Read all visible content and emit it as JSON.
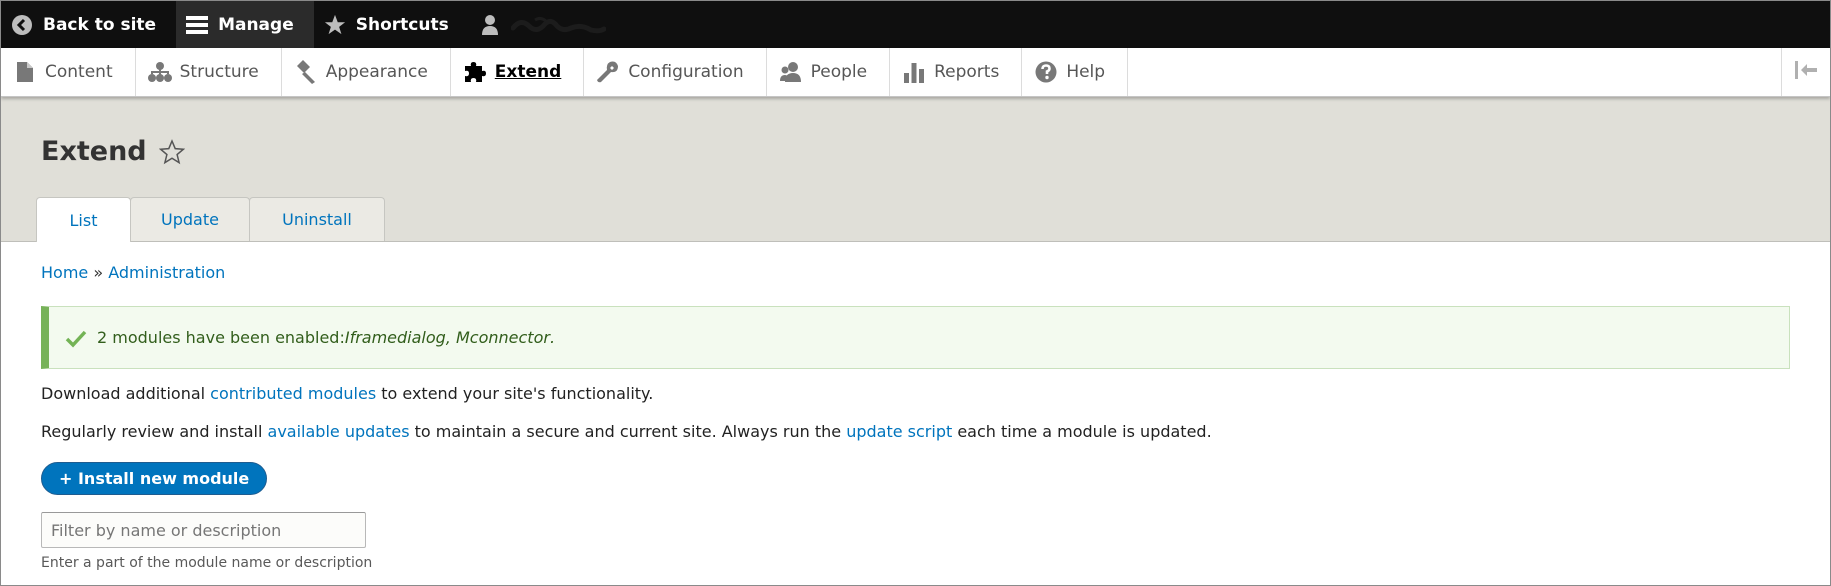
{
  "toolbar": {
    "back_label": "Back to site",
    "manage_label": "Manage",
    "shortcuts_label": "Shortcuts"
  },
  "tray": {
    "items": [
      {
        "label": "Content"
      },
      {
        "label": "Structure"
      },
      {
        "label": "Appearance"
      },
      {
        "label": "Extend"
      },
      {
        "label": "Configuration"
      },
      {
        "label": "People"
      },
      {
        "label": "Reports"
      },
      {
        "label": "Help"
      }
    ]
  },
  "page": {
    "title": "Extend",
    "tabs": [
      {
        "label": "List"
      },
      {
        "label": "Update"
      },
      {
        "label": "Uninstall"
      }
    ]
  },
  "breadcrumb": {
    "home": "Home",
    "separator": " » ",
    "admin": "Administration"
  },
  "message": {
    "prefix": "2 modules have been enabled: ",
    "modules": "Iframedialog, Mconnector",
    "suffix": "."
  },
  "content": {
    "p1_before": "Download additional ",
    "p1_link": "contributed modules",
    "p1_after": " to extend your site's functionality.",
    "p2_before": "Regularly review and install ",
    "p2_link1": "available updates",
    "p2_middle": " to maintain a secure and current site. Always run the ",
    "p2_link2": "update script",
    "p2_after": " each time a module is updated.",
    "install_button": "+ Install new module"
  },
  "filter": {
    "placeholder": "Filter by name or description",
    "value": "",
    "description": "Enter a part of the module name or description"
  },
  "colors": {
    "toolbar_bg": "#0f0f0f",
    "link": "#0074bd",
    "header_bg": "#e0dfd8",
    "success_bg": "#f3faef",
    "success_border": "#77b259"
  },
  "icons": {
    "back": "circle-chevron-left-icon",
    "manage": "hamburger-icon",
    "shortcuts": "star-icon",
    "user": "user-icon",
    "content": "file-icon",
    "structure": "sitemap-icon",
    "appearance": "paintbrush-icon",
    "extend": "puzzle-icon",
    "configuration": "wrench-icon",
    "people": "people-icon",
    "reports": "bar-chart-icon",
    "help": "question-icon",
    "collapse": "collapse-icon",
    "favorite": "star-outline-icon",
    "check": "check-icon"
  }
}
